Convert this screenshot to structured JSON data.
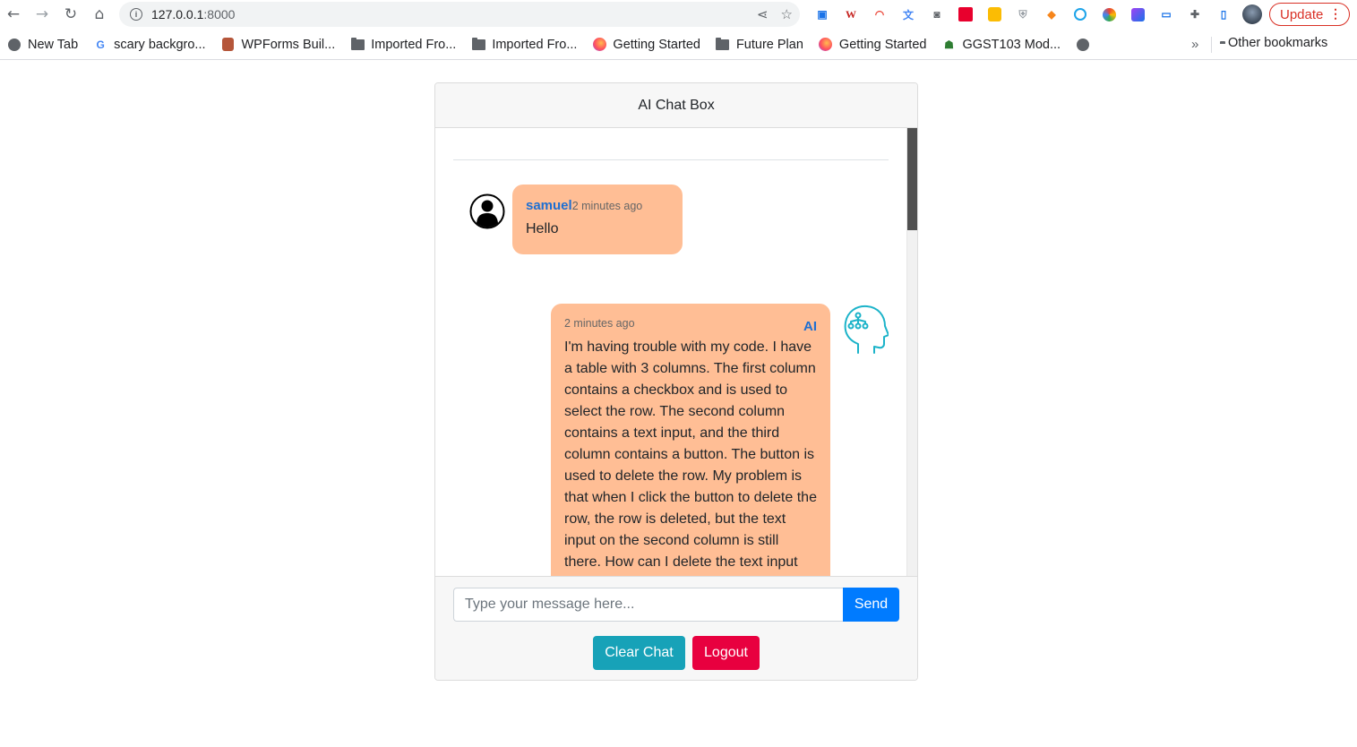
{
  "browser": {
    "url_host": "127.0.0.1",
    "url_port": ":8000",
    "update_label": "Update",
    "bookmarks": [
      {
        "label": "New Tab",
        "icon": "globe-icon"
      },
      {
        "label": "scary backgro...",
        "icon": "google-icon"
      },
      {
        "label": "WPForms Buil...",
        "icon": "wpforms-icon"
      },
      {
        "label": "Imported Fro...",
        "icon": "folder-icon"
      },
      {
        "label": "Imported Fro...",
        "icon": "folder-icon"
      },
      {
        "label": "Getting Started",
        "icon": "firefox-icon"
      },
      {
        "label": "Future Plan",
        "icon": "folder-icon"
      },
      {
        "label": "Getting Started",
        "icon": "firefox-icon"
      },
      {
        "label": "GGST103 Mod...",
        "icon": "course-icon"
      }
    ],
    "other_bookmarks": "Other bookmarks",
    "more_glyph": "»"
  },
  "chat": {
    "title": "AI Chat Box",
    "messages": [
      {
        "sender": "samuel",
        "time": "2 minutes ago",
        "text": "Hello"
      },
      {
        "sender": "AI",
        "time": "2 minutes ago",
        "text": "I'm having trouble with my code. I have a table with 3 columns. The first column contains a checkbox and is used to select the row. The second column contains a text input, and the third column contains a button. The button is used to delete the row. My problem is that when I click the button to delete the row, the row is deleted, but the text input on the second column is still there. How can I delete the text input"
      }
    ],
    "input_placeholder": "Type your message here...",
    "send_label": "Send",
    "clear_label": "Clear Chat",
    "logout_label": "Logout"
  },
  "colors": {
    "bubble": "#ffbe95",
    "name": "#1f6fd1",
    "send": "#007bff",
    "clear": "#17a2b8",
    "logout": "#e8003f"
  }
}
